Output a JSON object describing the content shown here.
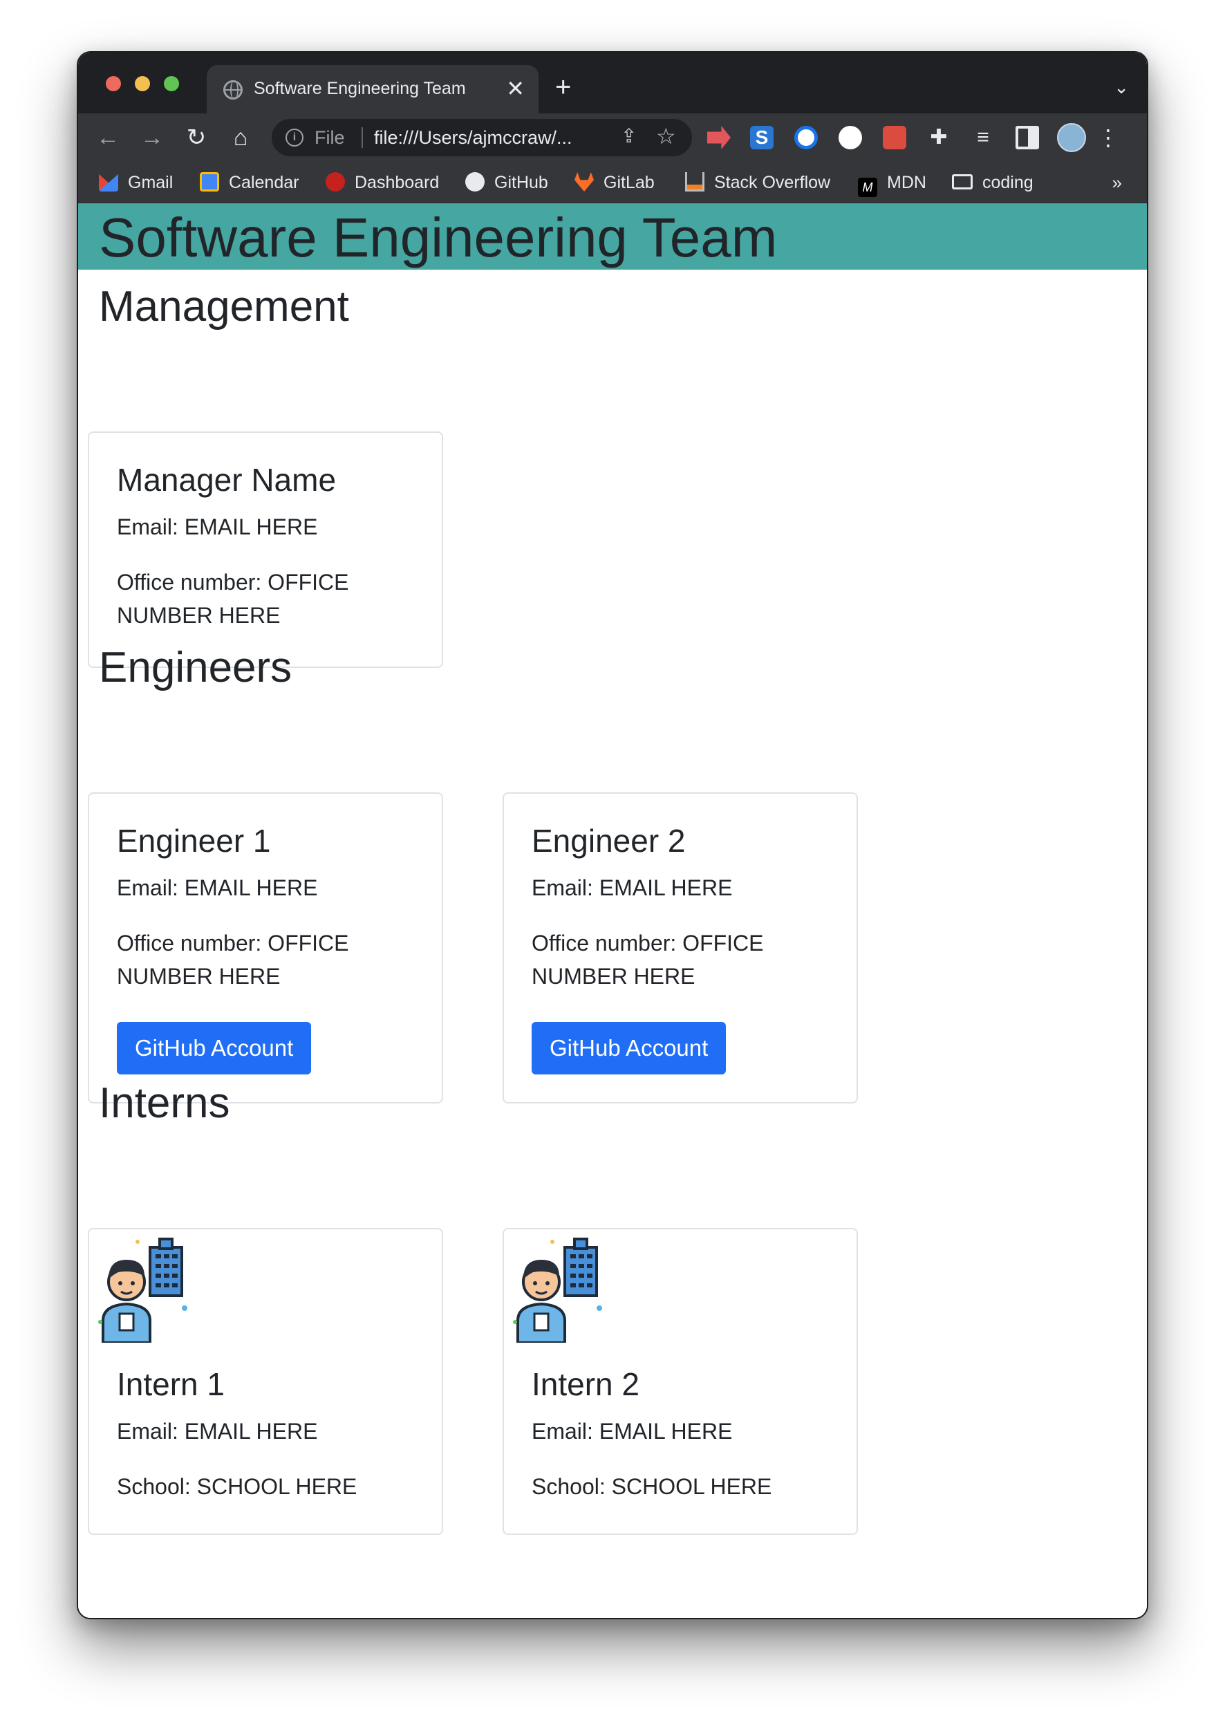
{
  "browser": {
    "tab_title": "Software Engineering Team",
    "tab_close": "✕",
    "new_tab": "+",
    "tab_menu": "⌄",
    "omnibox": {
      "scheme_label": "File",
      "url": "file:///Users/ajmccraw/..."
    },
    "nav": {
      "back": "←",
      "forward": "→",
      "reload": "↻",
      "home": "⌂"
    },
    "bookmarks": [
      "Gmail",
      "Calendar",
      "Dashboard",
      "GitHub",
      "GitLab",
      "Stack Overflow",
      "MDN",
      "coding"
    ],
    "bookmarks_more": "»"
  },
  "page": {
    "jumbotron_title": "Software Engineering Team",
    "sections": {
      "management": "Management",
      "engineers": "Engineers",
      "interns": "Interns"
    },
    "manager": {
      "name": "Manager Name",
      "email": "Email: EMAIL HERE",
      "office": "Office number: OFFICE NUMBER HERE"
    },
    "engineers": [
      {
        "name": "Engineer 1",
        "email": "Email: EMAIL HERE",
        "office": "Office number: OFFICE NUMBER HERE",
        "button": "GitHub Account"
      },
      {
        "name": "Engineer 2",
        "email": "Email: EMAIL HERE",
        "office": "Office number: OFFICE NUMBER HERE",
        "button": "GitHub Account"
      }
    ],
    "interns": [
      {
        "name": "Intern 1",
        "email": "Email: EMAIL HERE",
        "school": "School: SCHOOL HERE"
      },
      {
        "name": "Intern 2",
        "email": "Email: EMAIL HERE",
        "school": "School: SCHOOL HERE"
      }
    ]
  },
  "colors": {
    "jumbotron": "#46a6a1",
    "button": "#1f6ef5",
    "tab_bar": "#1f2023",
    "toolbar": "#35363a"
  }
}
